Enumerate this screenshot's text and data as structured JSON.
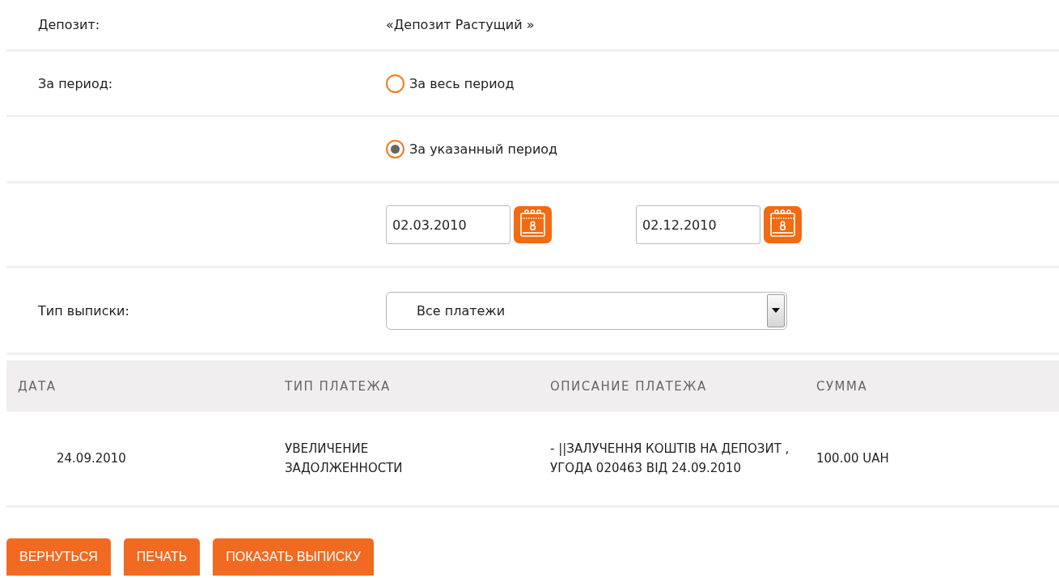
{
  "deposit": {
    "label": "Депозит:",
    "value": "«Депозит Растущий »"
  },
  "period": {
    "label": "За период:",
    "options": [
      {
        "label": "За весь период",
        "selected": false
      },
      {
        "label": "За указанный период",
        "selected": true
      }
    ]
  },
  "date_range": [
    {
      "value": "02.03.2010"
    },
    {
      "value": "02.12.2010"
    }
  ],
  "statement_type": {
    "label": "Тип выписки:",
    "value": "Все платежи"
  },
  "table": {
    "columns": [
      "ДАТА",
      "ТИП ПЛАТЕЖА",
      "ОПИСАНИЕ ПЛАТЕЖА",
      "СУММА"
    ],
    "rows": [
      {
        "cells": [
          "24.09.2010",
          "УВЕЛИЧЕНИЕ ЗАДОЛЖЕННОСТИ",
          "- ||ЗАЛУЧЕННЯ КОШТІВ НА ДЕПОЗИТ , УГОДА 020463 ВІД 24.09.2010",
          "100.00 UAH"
        ]
      }
    ]
  },
  "buttons": [
    "ВЕРНУТЬСЯ",
    "ПЕЧАТЬ",
    "ПОКАЗАТЬ ВЫПИСКУ"
  ]
}
